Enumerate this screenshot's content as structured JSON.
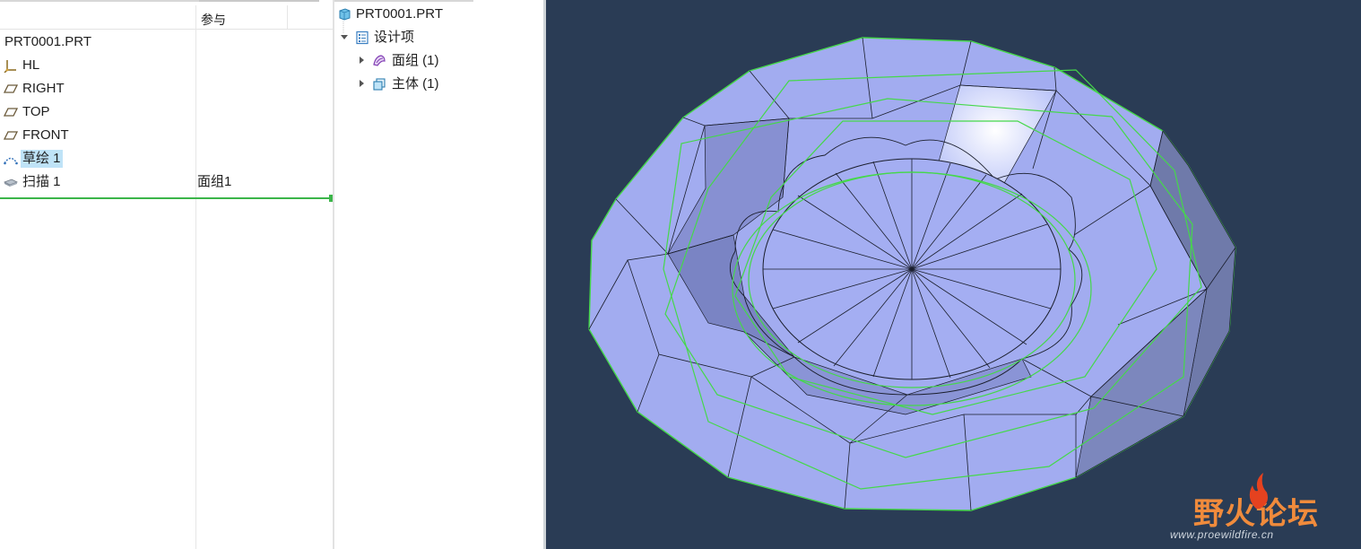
{
  "model_tree": {
    "column_ref_header": "参与",
    "items": [
      {
        "label": "PRT0001.PRT",
        "icon": "part-root",
        "ref": ""
      },
      {
        "label": "HL",
        "icon": "coordinate-system-icon",
        "ref": ""
      },
      {
        "label": "RIGHT",
        "icon": "datum-plane-icon",
        "ref": ""
      },
      {
        "label": "TOP",
        "icon": "datum-plane-icon",
        "ref": ""
      },
      {
        "label": "FRONT",
        "icon": "datum-plane-icon",
        "ref": ""
      },
      {
        "label": "草绘 1",
        "icon": "sketch-icon",
        "ref": "",
        "selected": true
      },
      {
        "label": "扫描 1",
        "icon": "sweep-icon",
        "ref": "面组1"
      }
    ]
  },
  "detail_tree": {
    "root": "PRT0001.PRT",
    "group": "设计项",
    "children": [
      {
        "label": "面组 (1)",
        "icon": "quilt-icon"
      },
      {
        "label": "主体 (1)",
        "icon": "body-icon"
      }
    ]
  },
  "viewport": {
    "background": "#2a3c55",
    "model_face_color": "#a2acf0",
    "edge_highlight_color": "#45d84a"
  },
  "watermark": {
    "text": "野火论坛",
    "url": "www.proewildfire.cn"
  }
}
